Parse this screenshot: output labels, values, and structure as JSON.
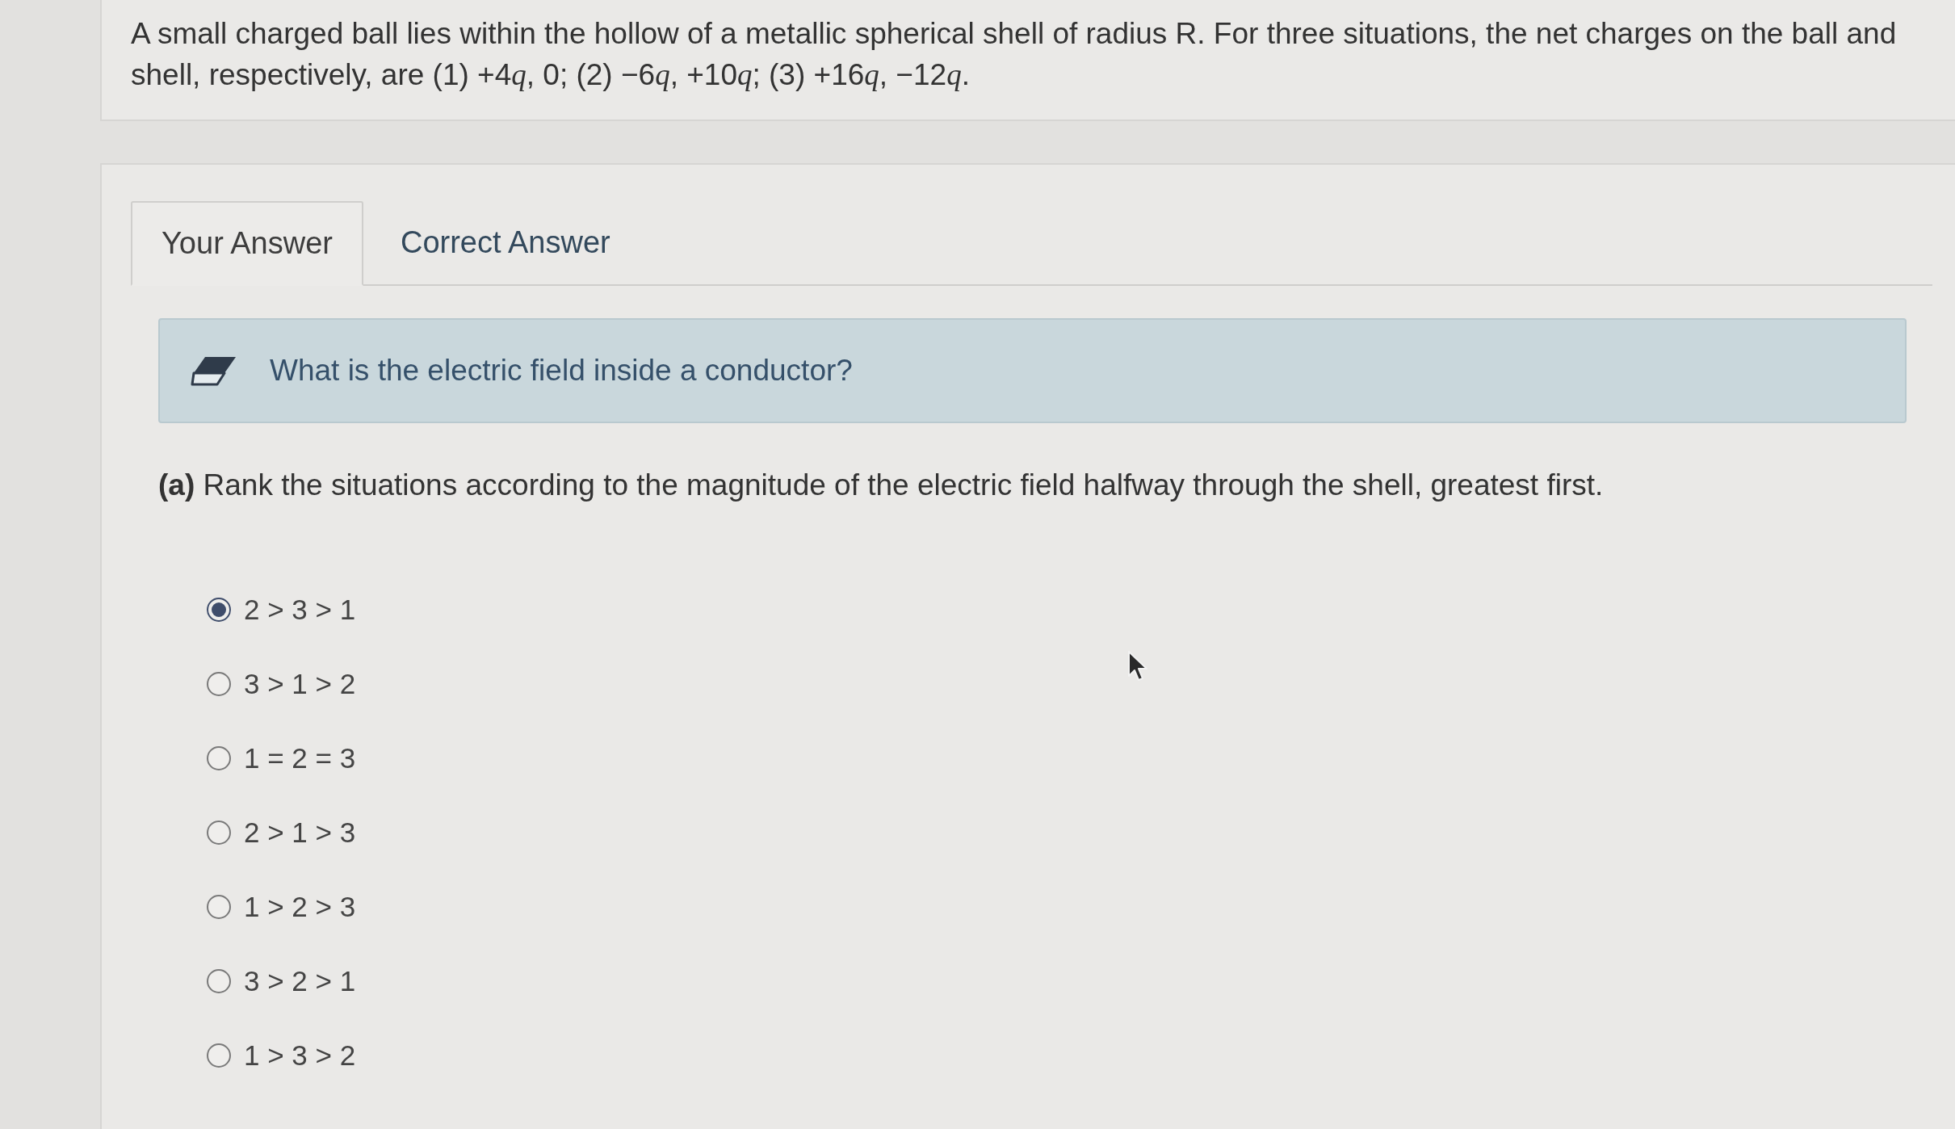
{
  "question": {
    "runs": [
      {
        "text": "A small charged ball lies within the hollow of a metallic spherical shell of radius R. For three situations, the net charges on the ball and shell, respectively, are (1) +4",
        "italic": false
      },
      {
        "text": "q",
        "italic": true
      },
      {
        "text": ", 0; (2) −6",
        "italic": false
      },
      {
        "text": "q",
        "italic": true
      },
      {
        "text": ", +10",
        "italic": false
      },
      {
        "text": "q",
        "italic": true
      },
      {
        "text": "; (3) +16",
        "italic": false
      },
      {
        "text": "q",
        "italic": true
      },
      {
        "text": ", −12",
        "italic": false
      },
      {
        "text": "q",
        "italic": true
      },
      {
        "text": ".",
        "italic": false
      }
    ]
  },
  "tabs": [
    {
      "label": "Your Answer",
      "selected": true
    },
    {
      "label": "Correct Answer",
      "selected": false
    }
  ],
  "hint": {
    "text": "What is the electric field inside a conductor?"
  },
  "part": {
    "text": "**(a)** Rank the situations according to the magnitude of the electric field halfway through the shell, greatest first."
  },
  "options": [
    {
      "label": "2 > 3 > 1",
      "selected": true
    },
    {
      "label": "3 > 1 > 2",
      "selected": false
    },
    {
      "label": "1 = 2 = 3",
      "selected": false
    },
    {
      "label": "2 > 1 > 3",
      "selected": false
    },
    {
      "label": "1 > 2 > 3",
      "selected": false
    },
    {
      "label": "3 > 2 > 1",
      "selected": false
    },
    {
      "label": "1 > 3 > 2",
      "selected": false
    }
  ]
}
